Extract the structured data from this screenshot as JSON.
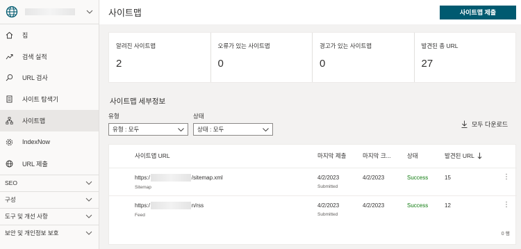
{
  "sidebar": {
    "nav": [
      {
        "label": "집",
        "icon": "home-icon"
      },
      {
        "label": "검색 실적",
        "icon": "trend-icon"
      },
      {
        "label": "URL 검사",
        "icon": "search-icon"
      },
      {
        "label": "사이트 탐색기",
        "icon": "document-icon"
      },
      {
        "label": "사이트맵",
        "icon": "sitemap-icon"
      },
      {
        "label": "IndexNow",
        "icon": "gear-icon"
      },
      {
        "label": "URL 제출",
        "icon": "globe-icon"
      }
    ],
    "groups": [
      {
        "label": "SEO"
      },
      {
        "label": "구성"
      },
      {
        "label": "도구 및 개선 사항"
      },
      {
        "label": "보안 및 개인정보 보호"
      }
    ]
  },
  "header": {
    "title": "사이트맵",
    "submit_label": "사이트맵 제출"
  },
  "stats": [
    {
      "label": "알려진 사이트맵",
      "value": "2"
    },
    {
      "label": "오류가 있는 사이트맵",
      "value": "0"
    },
    {
      "label": "경고가 있는 사이트맵",
      "value": "0"
    },
    {
      "label": "발견된 총 URL",
      "value": "27"
    }
  ],
  "details": {
    "title": "사이트맵 세부정보",
    "type_label": "유형",
    "type_value": "유형 : 모두",
    "status_label": "상태",
    "status_value": "상태 : 모두",
    "download_label": "모두 다운로드"
  },
  "table": {
    "columns": {
      "url": "사이트맵 URL",
      "last_submitted": "마지막 제출",
      "last_crawled": "마지막 크...",
      "status": "상태",
      "discovered": "발견된 URL"
    },
    "rows": [
      {
        "url_prefix": "https:/",
        "url_suffix": "/sitemap.xml",
        "type": "Sitemap",
        "submitted": "4/2/2023",
        "submitted_sub": "Submitted",
        "crawled": "4/2/2023",
        "status": "Success",
        "discovered": "15"
      },
      {
        "url_prefix": "https:/",
        "url_suffix": "n/rss",
        "type": "Feed",
        "submitted": "4/2/2023",
        "submitted_sub": "Submitted",
        "crawled": "4/2/2023",
        "status": "Success",
        "discovered": "12"
      }
    ],
    "footer_count": "0 행"
  },
  "colors": {
    "accent": "#005a70",
    "success": "#107c10"
  }
}
